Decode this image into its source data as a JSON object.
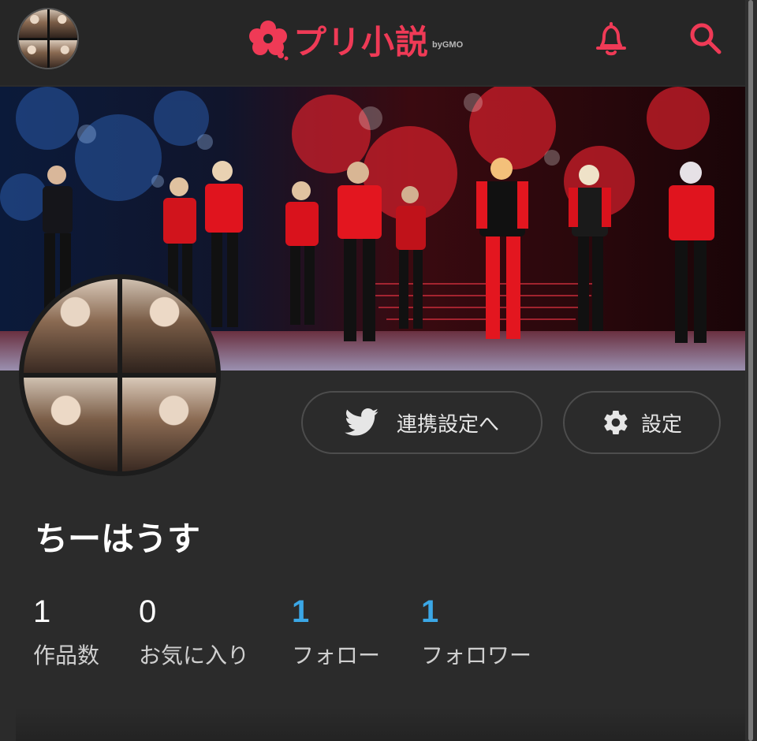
{
  "app": {
    "logo_text": "プリ小説",
    "logo_by": "byGMO",
    "brand_color": "#ef3a56",
    "accent_color": "#3ba7e6"
  },
  "header": {
    "icons": [
      "avatar",
      "bell-icon",
      "search-icon"
    ]
  },
  "profile": {
    "username": "ちーはうす",
    "buttons": {
      "link_label": "連携設定へ",
      "link_icon": "twitter-icon",
      "settings_label": "設定",
      "settings_icon": "gear-icon"
    },
    "stats": [
      {
        "value": "1",
        "label": "作品数"
      },
      {
        "value": "0",
        "label": "お気に入り"
      },
      {
        "value": "1",
        "label": "フォロー"
      },
      {
        "value": "1",
        "label": "フォロワー"
      }
    ]
  }
}
